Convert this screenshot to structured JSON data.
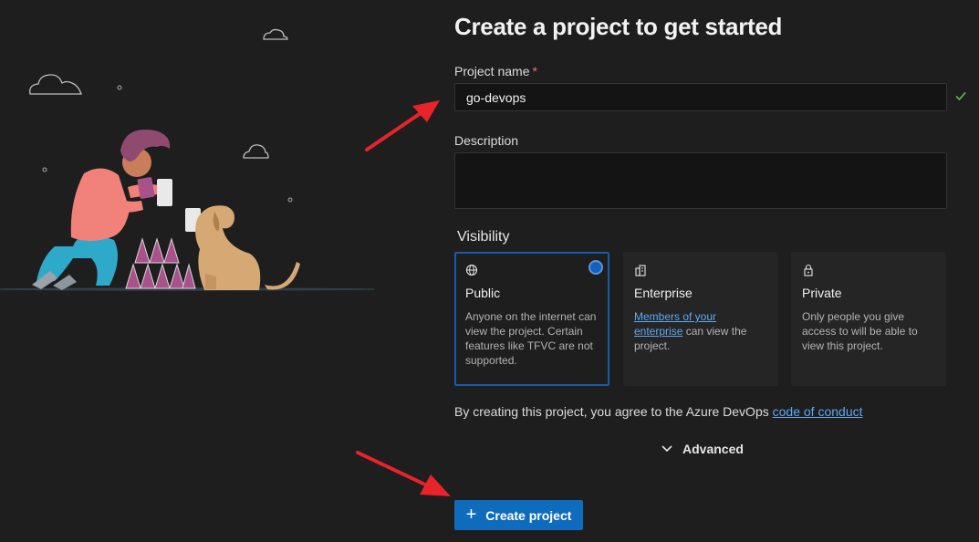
{
  "page": {
    "title": "Create a project to get started"
  },
  "form": {
    "project_name": {
      "label": "Project name",
      "required_mark": "*",
      "value": "go-devops"
    },
    "description": {
      "label": "Description",
      "value": ""
    },
    "visibility": {
      "label": "Visibility",
      "options": [
        {
          "title": "Public",
          "icon": "globe-icon",
          "description": "Anyone on the internet can view the project. Certain features like TFVC are not supported.",
          "selected": true
        },
        {
          "title": "Enterprise",
          "icon": "building-icon",
          "link_text": "Members of your enterprise",
          "description_rest": " can view the project.",
          "selected": false
        },
        {
          "title": "Private",
          "icon": "lock-icon",
          "description": "Only people you give access to will be able to view this project.",
          "selected": false
        }
      ]
    },
    "agreement": {
      "text": "By creating this project, you agree to the Azure DevOps ",
      "link_text": "code of conduct"
    },
    "advanced_label": "Advanced",
    "create_button": {
      "label": "Create project",
      "icon": "plus"
    }
  },
  "colors": {
    "background": "#1e1e1e",
    "accent": "#0f6cbd",
    "link": "#5ea8ef",
    "valid_check": "#6cbf6c",
    "annotation_arrow": "#e8232a"
  }
}
